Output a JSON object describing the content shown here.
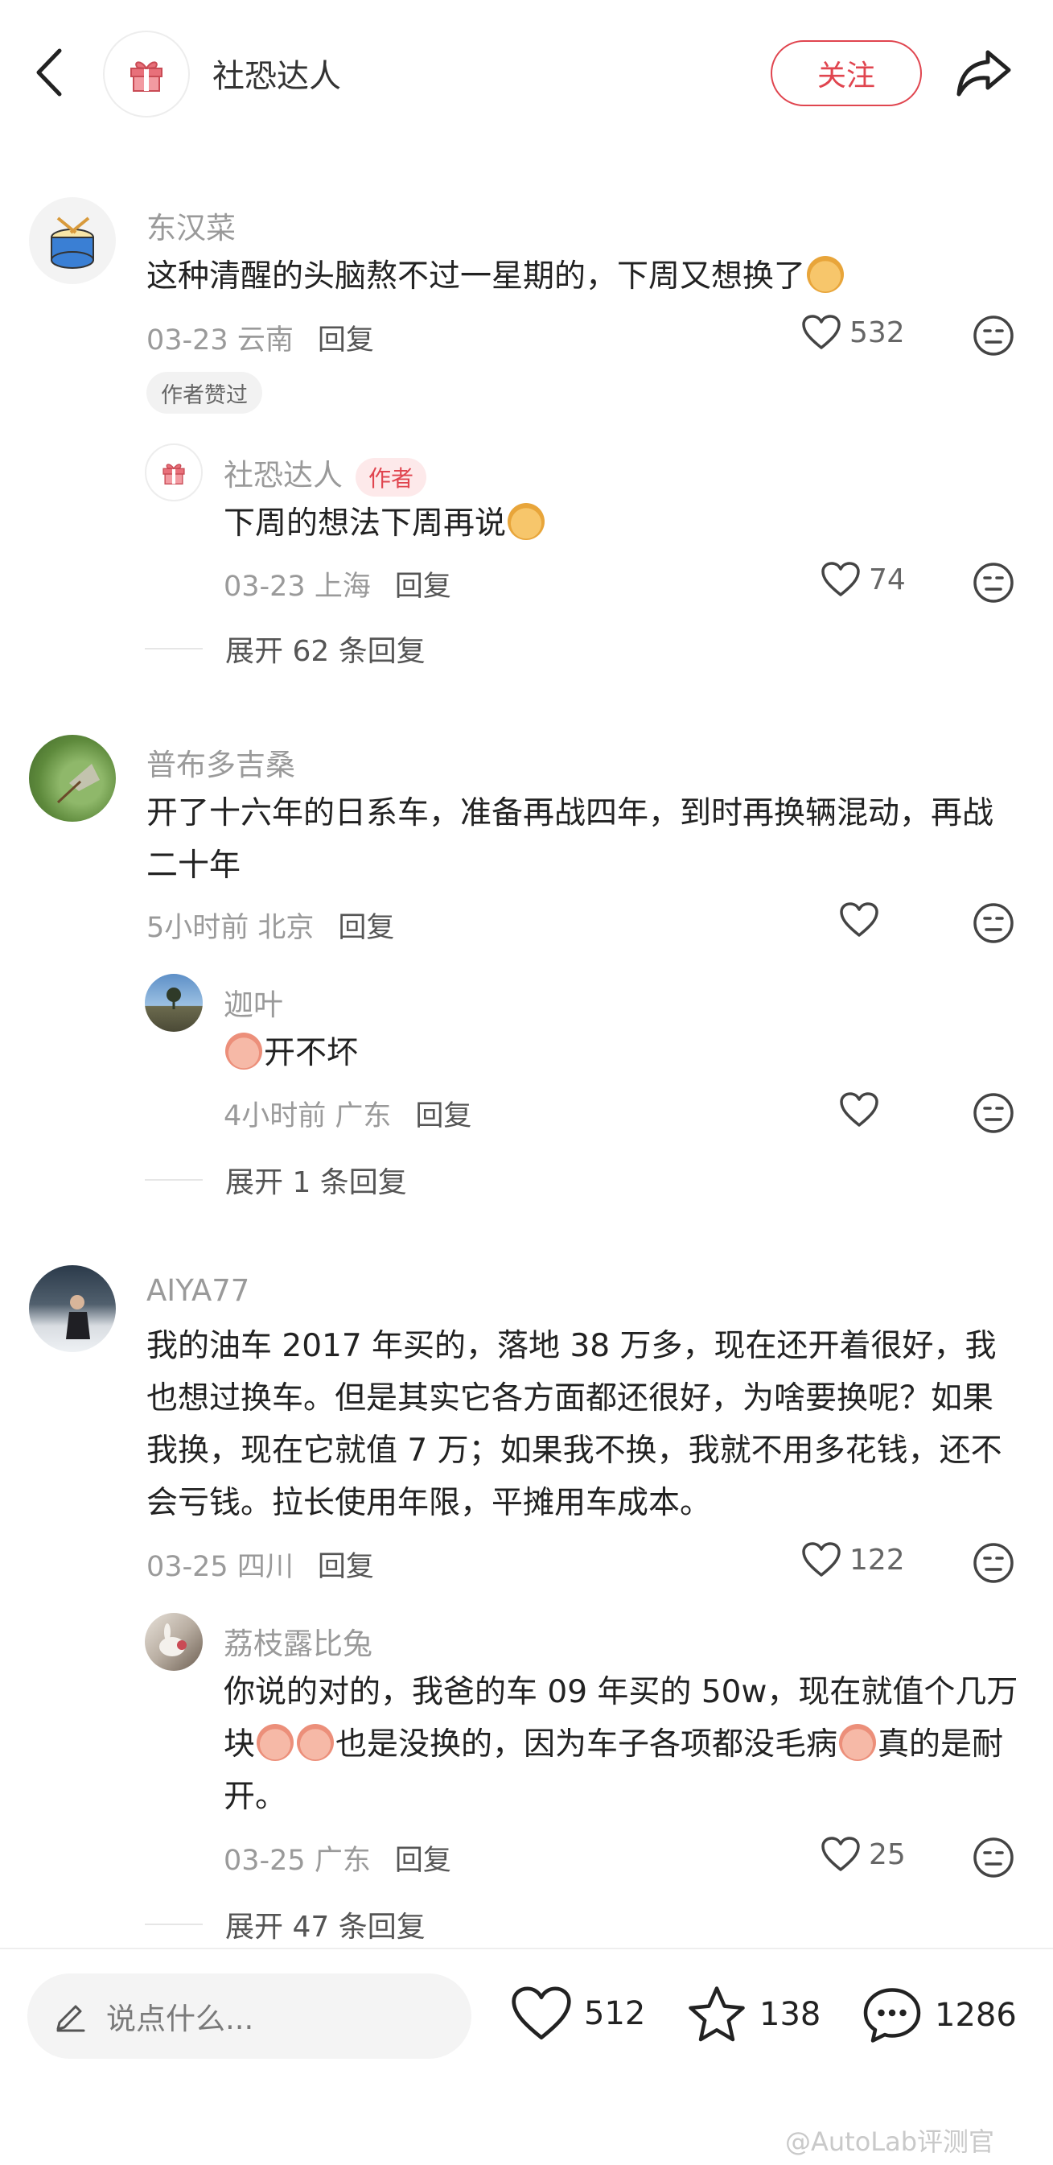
{
  "header": {
    "title": "社恐达人",
    "follow_label": "关注"
  },
  "comments": [
    {
      "user": "东汉菜",
      "text": "这种清醒的头脑熬不过一星期的，下周又想换了",
      "date": "03-23 云南",
      "reply_label": "回复",
      "likes": "532",
      "badge": "作者赞过",
      "replies": [
        {
          "user": "社恐达人",
          "tag": "作者",
          "text": "下周的想法下周再说",
          "date": "03-23 上海",
          "reply_label": "回复",
          "likes": "74"
        }
      ],
      "expand_label": "展开 62 条回复"
    },
    {
      "user": "普布多吉桑",
      "text": "开了十六年的日系车，准备再战四年，到时再换辆混动，再战二十年",
      "date": "5小时前 北京",
      "reply_label": "回复",
      "likes": "",
      "replies": [
        {
          "user": "迦叶",
          "text": "开不坏",
          "date": "4小时前 广东",
          "reply_label": "回复",
          "likes": ""
        }
      ],
      "expand_label": "展开 1 条回复"
    },
    {
      "user": "AIYA77",
      "text": "我的油车 2017 年买的，落地 38 万多，现在还开着很好，我也想过换车。但是其实它各方面都还很好，为啥要换呢？如果我换，现在它就值 7 万；如果我不换，我就不用多花钱，还不会亏钱。拉长使用年限，平摊用车成本。",
      "date": "03-25 四川",
      "reply_label": "回复",
      "likes": "122",
      "replies": [
        {
          "user": "荔枝露比兔",
          "text_a": "你说的对的，我爸的车 09 年买的 50w，现在就值个几万块",
          "text_b": "也是没换的，因为车子各项都没毛病",
          "text_c": "真的是耐开。",
          "date": "03-25 广东",
          "reply_label": "回复",
          "likes": "25"
        }
      ],
      "expand_label": "展开 47 条回复"
    }
  ],
  "bottom_bar": {
    "input_placeholder": "说点什么...",
    "likes": "512",
    "favorites": "138",
    "comments": "1286"
  },
  "watermark": "@AutoLab评测官",
  "icons": {
    "back": "chevron-left-icon",
    "share": "share-arrow-icon",
    "like": "heart-icon",
    "emoji": "neutral-face-icon",
    "edit": "pencil-icon",
    "star": "star-icon",
    "comment": "chat-bubble-icon"
  },
  "colors": {
    "accent": "#e0454f",
    "muted_text": "#9a9a9a",
    "body_text": "#222222"
  }
}
